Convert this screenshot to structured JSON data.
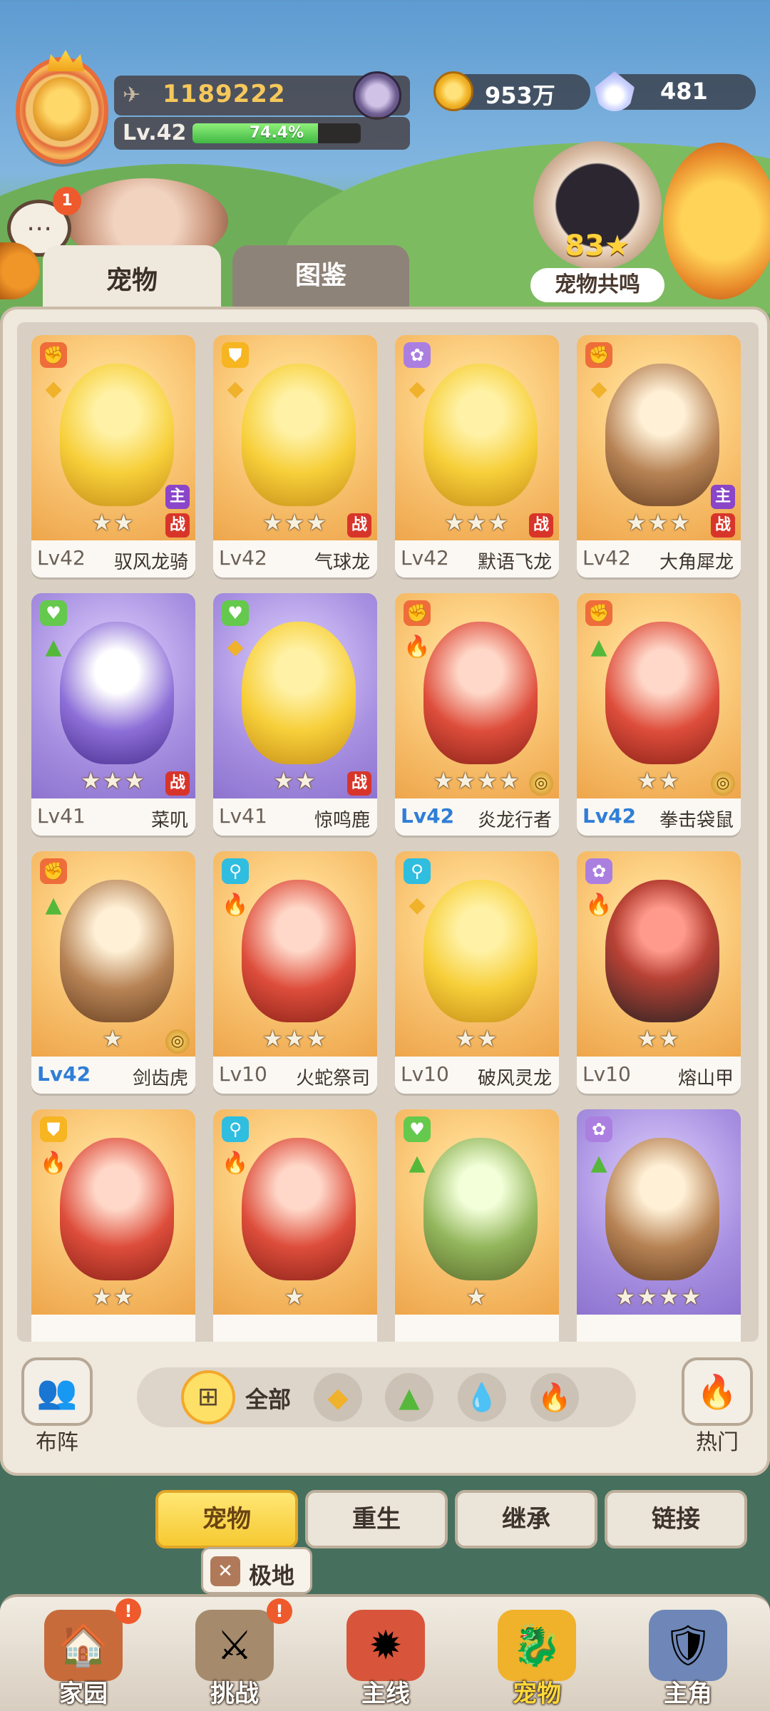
{
  "player": {
    "power": "1189222",
    "level": "Lv.42",
    "xp_percent": "74.4%",
    "xp_fraction": 0.744
  },
  "currency": {
    "coins": "953万",
    "shells": "481"
  },
  "chat": {
    "badge": "1"
  },
  "resonance": {
    "stars": "83★",
    "label": "宠物共鸣"
  },
  "tabs": {
    "pets": "宠物",
    "atlas": "图鉴"
  },
  "pets": [
    {
      "level": "Lv42",
      "name": "驭风龙骑",
      "stars": "★★",
      "tags": [
        "atk-icon",
        "earth-icon"
      ],
      "flags": [
        "主",
        "战"
      ],
      "bg": "orange",
      "creature": "yellow",
      "level_blue": false
    },
    {
      "level": "Lv42",
      "name": "气球龙",
      "stars": "★★★",
      "tags": [
        "def-icon",
        "earth-icon"
      ],
      "flags": [
        "战"
      ],
      "bg": "orange",
      "creature": "yellow",
      "level_blue": false
    },
    {
      "level": "Lv42",
      "name": "默语飞龙",
      "stars": "★★★",
      "tags": [
        "sup-icon",
        "earth-icon"
      ],
      "flags": [
        "战"
      ],
      "bg": "orange",
      "creature": "yellow",
      "level_blue": false
    },
    {
      "level": "Lv42",
      "name": "大角犀龙",
      "stars": "★★★",
      "tags": [
        "atk-icon",
        "earth-icon"
      ],
      "flags": [
        "主",
        "战"
      ],
      "bg": "orange",
      "creature": "brown",
      "level_blue": false
    },
    {
      "level": "Lv41",
      "name": "菜叽",
      "stars": "★★★",
      "tags": [
        "hp-icon",
        "grass-icon"
      ],
      "flags": [
        "战"
      ],
      "bg": "purple",
      "creature": "purple",
      "level_blue": false
    },
    {
      "level": "Lv41",
      "name": "惊鸣鹿",
      "stars": "★★",
      "tags": [
        "hp-icon",
        "earth-icon"
      ],
      "flags": [
        "战"
      ],
      "bg": "purple",
      "creature": "yellow",
      "level_blue": false
    },
    {
      "level": "Lv42",
      "name": "炎龙行者",
      "stars": "★★★★",
      "tags": [
        "atk-icon",
        "fire-icon"
      ],
      "flags": [
        "coin"
      ],
      "bg": "orange",
      "creature": "red",
      "level_blue": true
    },
    {
      "level": "Lv42",
      "name": "拳击袋鼠",
      "stars": "★★",
      "tags": [
        "atk-icon",
        "grass-icon"
      ],
      "flags": [
        "coin"
      ],
      "bg": "orange",
      "creature": "red",
      "level_blue": true
    },
    {
      "level": "Lv42",
      "name": "剑齿虎",
      "stars": "★",
      "tags": [
        "atk-icon",
        "grass-icon"
      ],
      "flags": [
        "coin"
      ],
      "bg": "orange",
      "creature": "brown",
      "level_blue": true
    },
    {
      "level": "Lv10",
      "name": "火蛇祭司",
      "stars": "★★★",
      "tags": [
        "spd-icon",
        "fire-icon"
      ],
      "flags": [],
      "bg": "orange",
      "creature": "red",
      "level_blue": false
    },
    {
      "level": "Lv10",
      "name": "破风灵龙",
      "stars": "★★",
      "tags": [
        "spd-icon",
        "earth-icon"
      ],
      "flags": [],
      "bg": "orange",
      "creature": "yellow",
      "level_blue": false
    },
    {
      "level": "Lv10",
      "name": "熔山甲",
      "stars": "★★",
      "tags": [
        "sup-icon",
        "fire-icon"
      ],
      "flags": [],
      "bg": "orange",
      "creature": "dark",
      "level_blue": false
    },
    {
      "level": "",
      "name": "",
      "stars": "★★",
      "tags": [
        "def-icon",
        "fire-icon"
      ],
      "flags": [],
      "bg": "orange",
      "creature": "red",
      "level_blue": false
    },
    {
      "level": "",
      "name": "",
      "stars": "★",
      "tags": [
        "spd-icon",
        "fire-icon"
      ],
      "flags": [],
      "bg": "orange",
      "creature": "red",
      "level_blue": false
    },
    {
      "level": "",
      "name": "",
      "stars": "★",
      "tags": [
        "hp-icon",
        "grass-icon"
      ],
      "flags": [],
      "bg": "orange",
      "creature": "green",
      "level_blue": false
    },
    {
      "level": "",
      "name": "",
      "stars": "★★★★",
      "tags": [
        "sup-icon",
        "grass-icon"
      ],
      "flags": [],
      "bg": "purple",
      "creature": "brown",
      "level_blue": false
    }
  ],
  "controls": {
    "formation": "布阵",
    "filter_all": "全部",
    "hot": "热门",
    "filters": [
      "earth-element-icon",
      "grass-element-icon",
      "water-element-icon",
      "fire-element-icon"
    ]
  },
  "subtabs": [
    "宠物",
    "重生",
    "继承",
    "链接"
  ],
  "extreme_tip": {
    "label": "极地"
  },
  "nav": [
    {
      "label": "家园",
      "icon": "home-icon",
      "badge": "!"
    },
    {
      "label": "挑战",
      "icon": "challenge-icon",
      "badge": "!"
    },
    {
      "label": "主线",
      "icon": "mainline-icon",
      "badge": ""
    },
    {
      "label": "宠物",
      "icon": "pet-icon",
      "badge": "",
      "active": true
    },
    {
      "label": "主角",
      "icon": "hero-icon",
      "badge": ""
    }
  ],
  "colors": {
    "accent": "#f6c932",
    "xp": "#40b843",
    "level_blue": "#2f7ed7"
  }
}
